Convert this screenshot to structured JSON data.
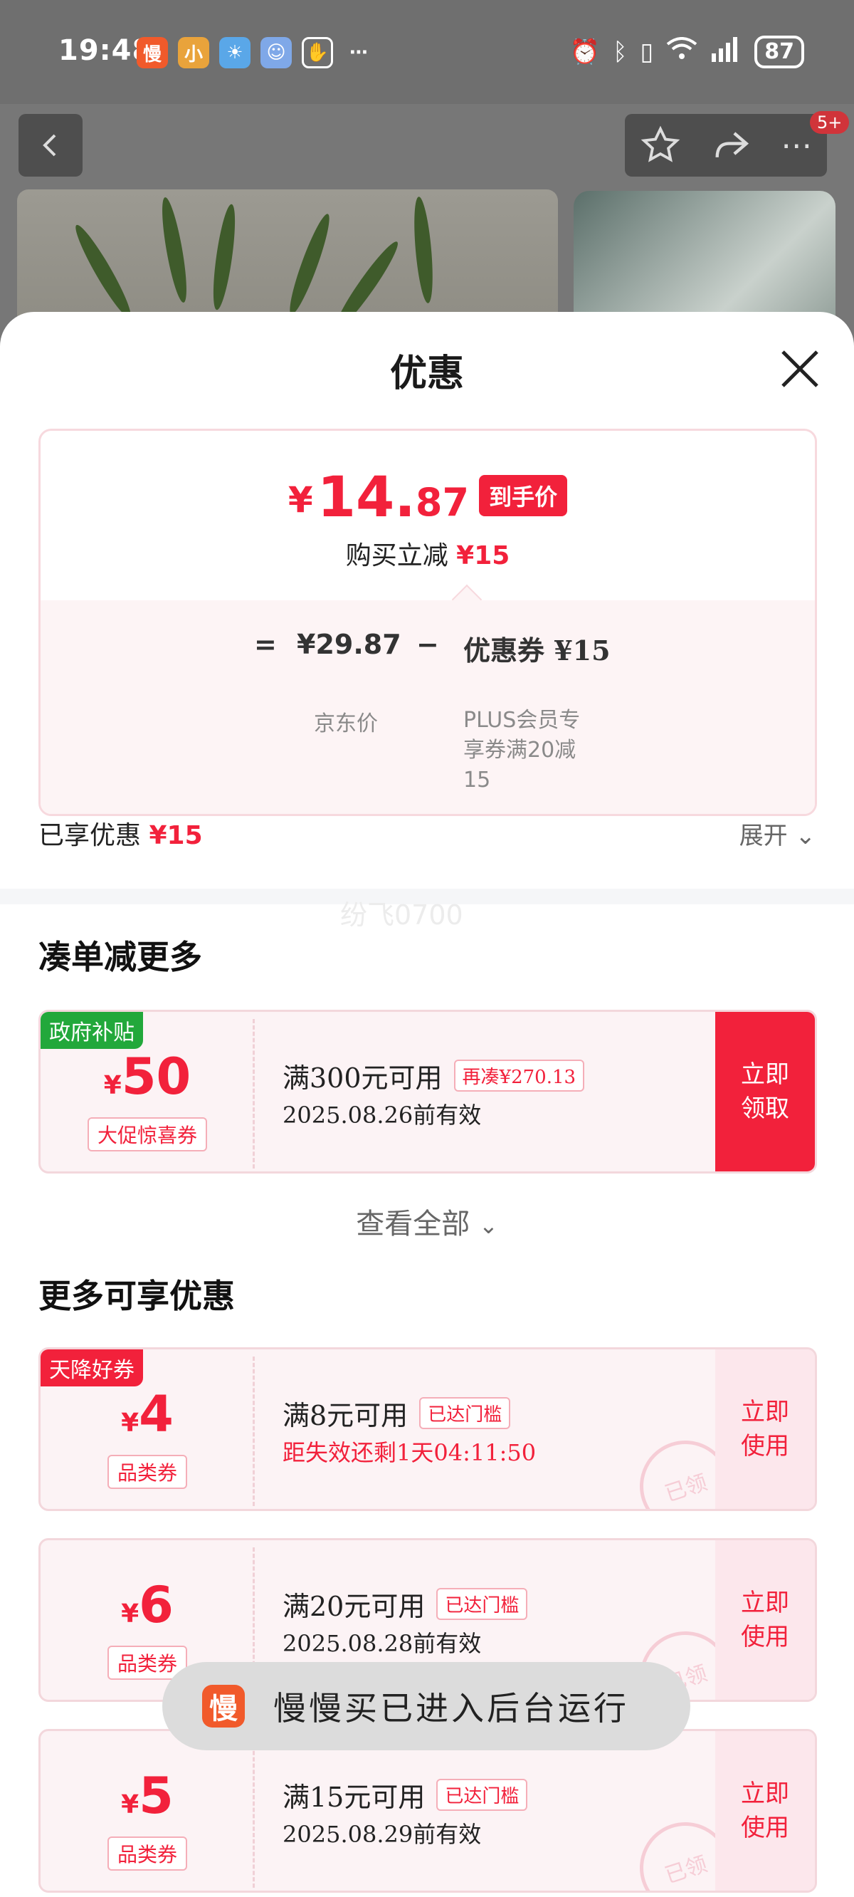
{
  "status_bar": {
    "time": "19:48",
    "apps": [
      {
        "name": "manmanmai-app-icon",
        "glyph": "慢",
        "color": "#f15a2b"
      },
      {
        "name": "xiaohongshu-app-icon",
        "glyph": "小",
        "color": "#e9a33b"
      },
      {
        "name": "weather-app-icon",
        "glyph": "☀",
        "color": "#5aa7e8"
      },
      {
        "name": "assistant-app-icon",
        "glyph": "☺",
        "color": "#7fa8e8"
      }
    ],
    "battery": "87"
  },
  "header": {
    "notification_badge": "5+"
  },
  "sheet": {
    "title": "优惠",
    "price_card": {
      "yen": "¥",
      "price_int": "14.",
      "price_dec": "87",
      "price_tag": "到手价",
      "sub_label": "购买立减",
      "sub_value": "¥15",
      "eq": "=",
      "jd_price": "¥29.87",
      "minus": "−",
      "coupon_value": "优惠券 ¥15",
      "jd_price_label": "京东价",
      "coupon_desc": "PLUS会员专享券满20减15"
    },
    "enjoyed_label": "已享优惠",
    "enjoyed_value": "¥15",
    "expand_label": "展开",
    "watermark": "纷飞0700"
  },
  "section_more_order": {
    "title": "凑单减更多",
    "coupon": {
      "tag": "政府补贴",
      "yen": "¥",
      "amount": "50",
      "kind": "大促惊喜券",
      "condition": "满300元可用",
      "pill": "再凑¥270.13",
      "date": "2025.08.26前有效",
      "button": "立即领取"
    },
    "view_all": "查看全部"
  },
  "section_more_discounts": {
    "title": "更多可享优惠",
    "coupons": [
      {
        "tag": "天降好券",
        "yen": "¥",
        "amount": "4",
        "kind": "品类券",
        "condition": "满8元可用",
        "pill": "已达门槛",
        "date": "距失效还剩1天04:11:50",
        "button": "立即使用",
        "stamp": "已领"
      },
      {
        "tag": "",
        "yen": "¥",
        "amount": "6",
        "kind": "品类券",
        "condition": "满20元可用",
        "pill": "已达门槛",
        "date": "2025.08.28前有效",
        "button": "立即使用",
        "stamp": "已领"
      },
      {
        "tag": "",
        "yen": "¥",
        "amount": "5",
        "kind": "品类券",
        "condition": "满15元可用",
        "pill": "已达门槛",
        "date": "2025.08.29前有效",
        "button": "立即使用",
        "stamp": "已领"
      }
    ]
  },
  "toast": {
    "icon_glyph": "慢",
    "text": "慢慢买已进入后台运行"
  },
  "colors": {
    "accent_red": "#f2213b",
    "green_tag": "#22a83b"
  }
}
